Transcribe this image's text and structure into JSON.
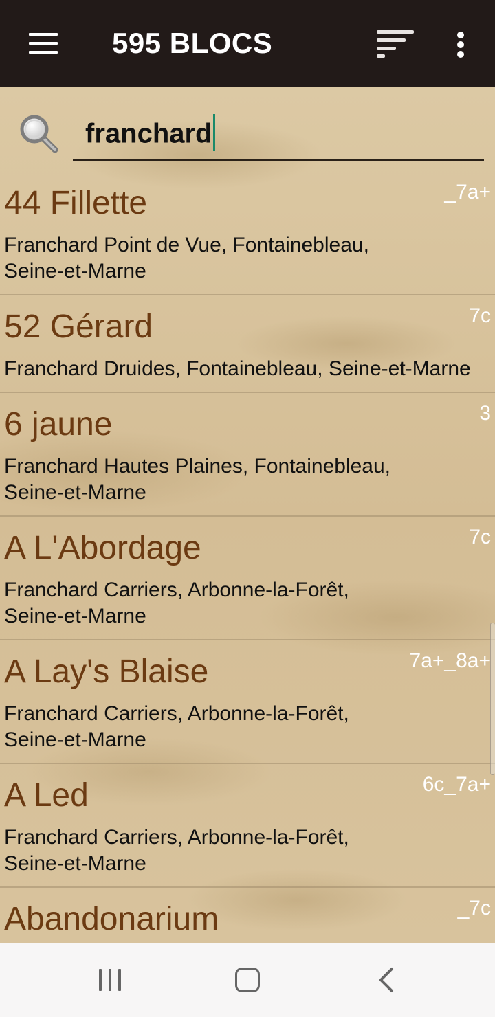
{
  "appbar": {
    "title": "595 BLOCS",
    "menu_icon": "hamburger-menu-icon",
    "sort_icon": "sort-icon",
    "more_icon": "more-vertical-icon"
  },
  "search": {
    "icon": "magnifier-icon",
    "value": "franchard"
  },
  "list": {
    "items": [
      {
        "name": "44 Fillette",
        "grade": "_7a+",
        "location": "Franchard Point de Vue, Fontainebleau, Seine-et-Marne"
      },
      {
        "name": "52 Gérard",
        "grade": "7c",
        "location": "Franchard Druides, Fontainebleau, Seine-et-Marne"
      },
      {
        "name": "6 jaune",
        "grade": "3",
        "location": "Franchard Hautes Plaines, Fontainebleau, Seine-et-Marne"
      },
      {
        "name": "A L'Abordage",
        "grade": "7c",
        "location": "Franchard Carriers, Arbonne-la-Forêt, Seine-et-Marne"
      },
      {
        "name": "A Lay's Blaise",
        "grade": "7a+_8a+",
        "location": "Franchard Carriers, Arbonne-la-Forêt, Seine-et-Marne"
      },
      {
        "name": "A Led",
        "grade": "6c_7a+",
        "location": "Franchard Carriers, Arbonne-la-Forêt, Seine-et-Marne"
      },
      {
        "name": "Abandonarium",
        "grade": "_7c",
        "location": ""
      }
    ]
  },
  "navbar": {
    "recents_icon": "recent-apps-icon",
    "home_icon": "home-icon",
    "back_icon": "back-icon"
  },
  "colors": {
    "appbar_bg": "#221a18",
    "item_name": "#6b3a12",
    "grade_text": "#ffffff",
    "caret": "#1a8a6a",
    "navbar_bg": "#f7f6f6"
  }
}
